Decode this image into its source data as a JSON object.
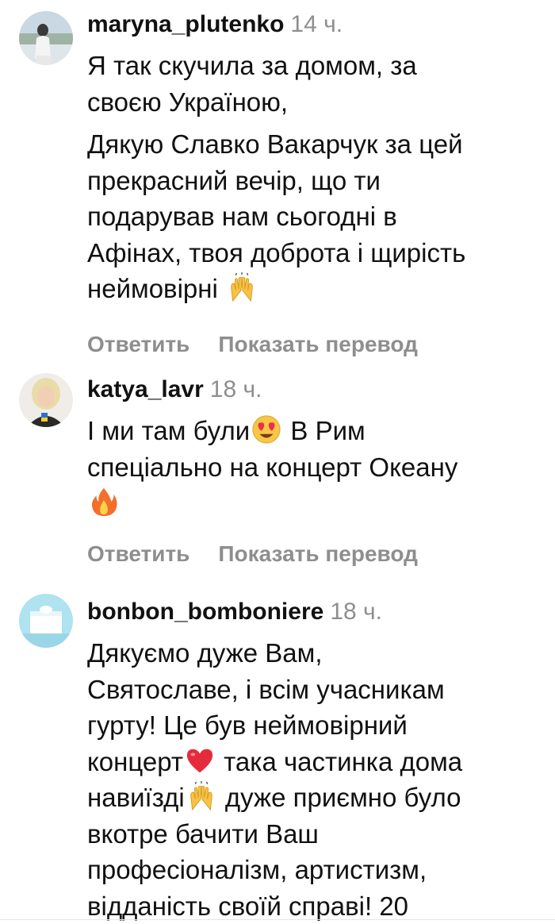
{
  "comments": [
    {
      "username": "maryna_plutenko",
      "time": "14 ч.",
      "paragraphs": [
        [
          "Я так скучила за домом, за",
          "своєю Україною,"
        ],
        [
          "Дякую Славко Вакарчук за цей",
          "прекрасний вечір, що ти",
          "подарував нам сьогодні в",
          "Афінах, твоя доброта і щирість",
          "неймовірні "
        ]
      ],
      "emoji": [
        "raising-hands-icon"
      ],
      "reply_label": "Ответить",
      "translate_label": "Показать перевод"
    },
    {
      "username": "katya_lavr",
      "time": "18 ч.",
      "lines": [
        "І ми там були",
        " В Рим",
        "спеціально на концерт Океану"
      ],
      "emoji": [
        "heart-eyes-icon",
        "fire-icon"
      ],
      "reply_label": "Ответить",
      "translate_label": "Показать перевод"
    },
    {
      "username": "bonbon_bomboniere",
      "time": "18 ч.",
      "lines": [
        "Дякуємо дуже Вам,",
        "Святославе, і всім учасникам",
        "гурту! Це був неймовірний",
        "концерт",
        " така частинка дома",
        "навиїзді",
        " дуже приємно було",
        "вкотре бачити Ваш",
        "професіоналізм, артистизм,",
        "відданість своїй справі! 20"
      ],
      "emoji": [
        "red-heart-icon",
        "raising-hands-icon"
      ]
    }
  ],
  "colors": {
    "text": "#111111",
    "muted": "#8e8e8e",
    "background": "#ffffff"
  }
}
